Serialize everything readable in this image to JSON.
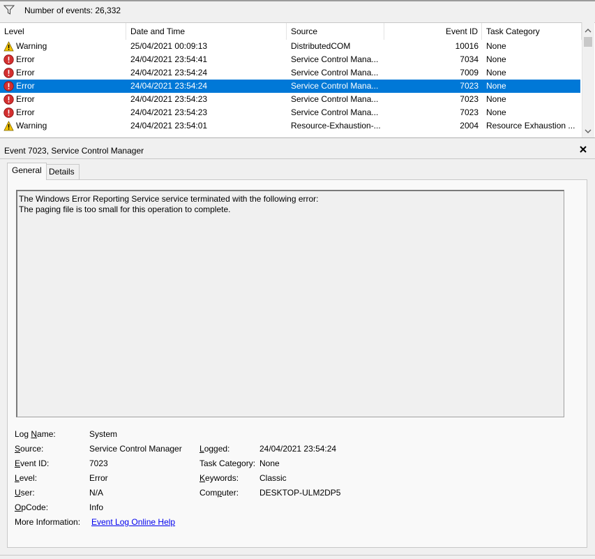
{
  "filter_bar": {
    "event_count_label": "Number of events: 26,332"
  },
  "events_table": {
    "columns": [
      "Level",
      "Date and Time",
      "Source",
      "Event ID",
      "Task Category"
    ],
    "rows": [
      {
        "level": "Warning",
        "icon": "warning-icon",
        "date": "25/04/2021 00:09:13",
        "source": "DistributedCOM",
        "event_id": "10016",
        "category": "None",
        "selected": false
      },
      {
        "level": "Error",
        "icon": "error-icon",
        "date": "24/04/2021 23:54:41",
        "source": "Service Control Mana...",
        "event_id": "7034",
        "category": "None",
        "selected": false
      },
      {
        "level": "Error",
        "icon": "error-icon",
        "date": "24/04/2021 23:54:24",
        "source": "Service Control Mana...",
        "event_id": "7009",
        "category": "None",
        "selected": false
      },
      {
        "level": "Error",
        "icon": "error-icon",
        "date": "24/04/2021 23:54:24",
        "source": "Service Control Mana...",
        "event_id": "7023",
        "category": "None",
        "selected": true
      },
      {
        "level": "Error",
        "icon": "error-icon",
        "date": "24/04/2021 23:54:23",
        "source": "Service Control Mana...",
        "event_id": "7023",
        "category": "None",
        "selected": false
      },
      {
        "level": "Error",
        "icon": "error-icon",
        "date": "24/04/2021 23:54:23",
        "source": "Service Control Mana...",
        "event_id": "7023",
        "category": "None",
        "selected": false
      },
      {
        "level": "Warning",
        "icon": "warning-icon",
        "date": "24/04/2021 23:54:01",
        "source": "Resource-Exhaustion-...",
        "event_id": "2004",
        "category": "Resource Exhaustion ...",
        "selected": false
      }
    ]
  },
  "detail": {
    "title": "Event 7023, Service Control Manager",
    "tabs": [
      "General",
      "Details"
    ],
    "active_tab": "General",
    "description_line1": "The Windows Error Reporting Service service terminated with the following error:",
    "description_line2": "The paging file is too small for this operation to complete.",
    "fields": {
      "log_name_label": "Log Name:",
      "log_name": "System",
      "source_label": "Source:",
      "source": "Service Control Manager",
      "logged_label": "Logged:",
      "logged": "24/04/2021 23:54:24",
      "event_id_label": "Event ID:",
      "event_id": "7023",
      "task_category_label": "Task Category:",
      "task_category": "None",
      "level_label": "Level:",
      "level": "Error",
      "keywords_label": "Keywords:",
      "keywords": "Classic",
      "user_label": "User:",
      "user": "N/A",
      "computer_label": "Computer:",
      "computer": "DESKTOP-ULM2DP5",
      "opcode_label": "OpCode:",
      "opcode": "Info",
      "more_info_label": "More Information:",
      "more_info_link": "Event Log Online Help"
    }
  },
  "colors": {
    "selection": "#0078d7",
    "link": "#0000ee",
    "error": "#d32f2f",
    "warning": "#f5c400"
  }
}
